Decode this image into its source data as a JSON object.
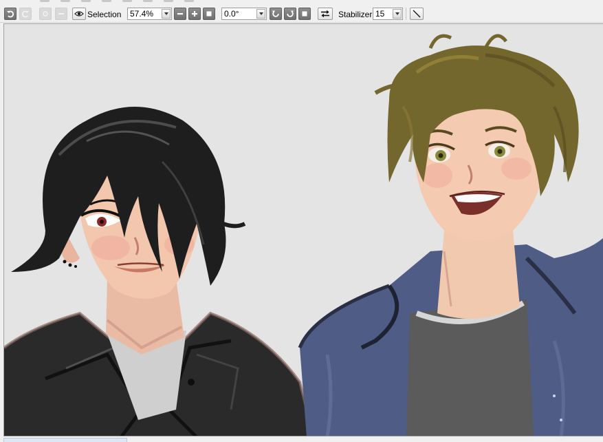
{
  "toolbar": {
    "selection_label": "Selection",
    "zoom_value": "57.4%",
    "rotation_value": "0.0°",
    "stabilizer_label": "Stabilizer",
    "stabilizer_value": "15"
  },
  "icons": {
    "undo": "undo-icon",
    "redo": "redo-icon",
    "view": "eye-icon",
    "zoom_out": "minus-icon",
    "zoom_in": "plus-icon",
    "zoom_reset": "square-icon",
    "rotate_left": "rotate-ccw-icon",
    "rotate_right": "rotate-cw-icon",
    "rotate_reset": "square-icon",
    "flip": "flip-arrows-icon",
    "line": "diagonal-line-icon"
  },
  "colors": {
    "canvas_bg": "#e4e4e4",
    "hair_dark": "#1e1e1e",
    "hair_brown": "#74672e",
    "jacket_black": "#2b2b2b",
    "jacket_blue": "#4f5d86",
    "shirt_dark": "#5b5b5b",
    "skin": "#f2c7ad"
  }
}
